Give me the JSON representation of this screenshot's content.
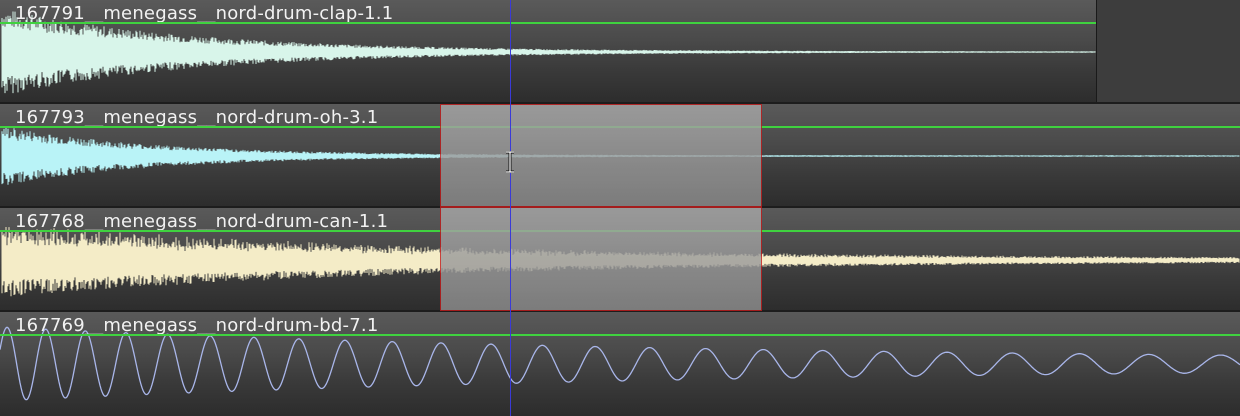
{
  "colors": {
    "gain_line": "#3fd23f",
    "playhead": "#3a3ad8",
    "selection_border": "#c21c1c",
    "clap_wave": "#d8f5ea",
    "oh_wave": "#b9f3f7",
    "can_wave": "#f4ecc7",
    "bd_wave": "#a9b6ea"
  },
  "tracks": [
    {
      "title": "167791__menegass__nord-drum-clap-1.1",
      "wave_type": "clap"
    },
    {
      "title": "167793__menegass__nord-drum-oh-3.1",
      "wave_type": "hihat"
    },
    {
      "title": "167768__menegass__nord-drum-can-1.1",
      "wave_type": "can"
    },
    {
      "title": "167769__menegass__nord-drum-bd-7.1",
      "wave_type": "kick"
    }
  ],
  "icons": {
    "cursor": "text-cursor-icon"
  }
}
